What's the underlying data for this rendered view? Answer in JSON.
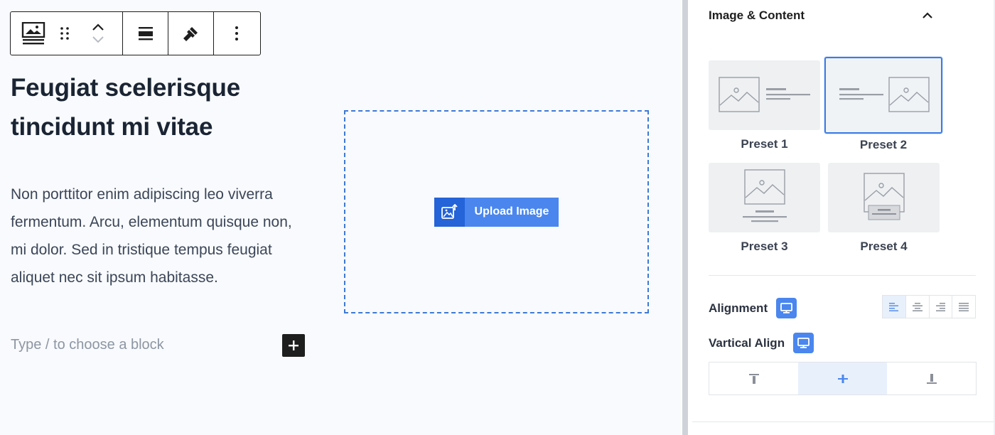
{
  "toolbar": {
    "buttons": [
      {
        "name": "block-type",
        "icon": "media-text-icon"
      },
      {
        "name": "drag-handle",
        "icon": "drag-dots-icon"
      },
      {
        "name": "move-up",
        "icon": "chevron-up-icon"
      },
      {
        "name": "move-down",
        "icon": "chevron-down-icon"
      },
      {
        "name": "align",
        "icon": "align-center-icon"
      },
      {
        "name": "styles",
        "icon": "brush-icon"
      },
      {
        "name": "options",
        "icon": "more-vertical-icon"
      }
    ]
  },
  "content": {
    "heading": "Feugiat scelerisque tincidunt mi vitae",
    "paragraph": "Non porttitor enim adipiscing leo viverra fermentum. Arcu, elementum quisque non, mi dolor. Sed in tristique tempus feugiat aliquet nec sit ipsum habitasse.",
    "block_placeholder": "Type / to choose a block"
  },
  "upload": {
    "button_label": "Upload Image"
  },
  "sidebar": {
    "panel_title": "Image & Content",
    "presets": [
      {
        "label": "Preset 1",
        "selected": false
      },
      {
        "label": "Preset 2",
        "selected": true
      },
      {
        "label": "Preset 3",
        "selected": false
      },
      {
        "label": "Preset 4",
        "selected": false
      }
    ],
    "alignment_label": "Alignment",
    "alignment_options": [
      "left",
      "center",
      "right",
      "justify"
    ],
    "alignment_selected": "left",
    "vertical_align_label": "Vartical Align",
    "vertical_align_options": [
      "top",
      "center",
      "bottom"
    ],
    "vertical_align_selected": "center"
  },
  "colors": {
    "accent": "#4a86ee",
    "accent_dark": "#2463d8",
    "dashed_border": "#3d7ad6",
    "selected_border": "#3b7ce6"
  }
}
